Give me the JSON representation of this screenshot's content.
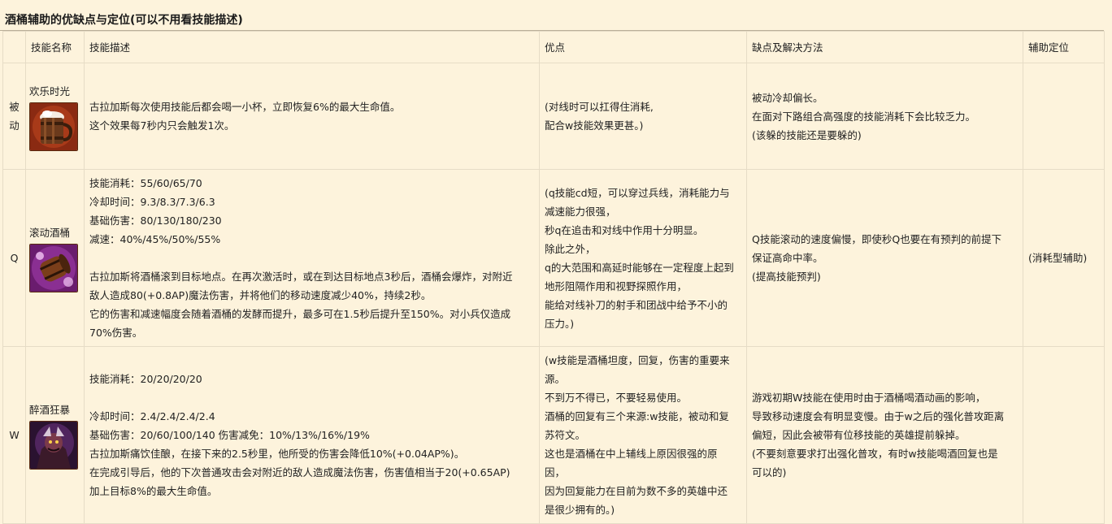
{
  "page": {
    "title": "酒桶辅助的优缺点与定位(可以不用看技能描述)"
  },
  "table": {
    "headers": [
      "",
      "技能名称",
      "技能描述",
      "优点",
      "缺点及解决方法",
      "辅助定位"
    ],
    "rows": [
      {
        "slot": "被\n动",
        "name": "欢乐时光",
        "icon": "beer-mug-icon",
        "desc": [
          "古拉加斯每次使用技能后都会喝一小杯，立即恢复6%的最大生命值。",
          "这个效果每7秒内只会触发1次。"
        ],
        "pros": [
          "(对线时可以扛得住消耗,",
          "配合w技能效果更甚。)"
        ],
        "cons": [
          "被动冷却偏长。",
          "在面对下路组合高强度的技能消耗下会比较乏力。",
          "(该躲的技能还是要躲的)"
        ],
        "role": ""
      },
      {
        "slot": "Q",
        "name": "滚动酒桶",
        "icon": "rolling-barrel-icon",
        "desc": [
          "技能消耗：55/60/65/70",
          "冷却时间：9.3/8.3/7.3/6.3",
          "基础伤害：80/130/180/230",
          "减速：40%/45%/50%/55%",
          "",
          "古拉加斯将酒桶滚到目标地点。在再次激活时，或在到达目标地点3秒后，酒桶会爆炸，对附近",
          "敌人造成80(+0.8AP)魔法伤害，并将他们的移动速度减少40%，持续2秒。",
          "它的伤害和减速幅度会随着酒桶的发酵而提升，最多可在1.5秒后提升至150%。对小兵仅造成",
          "70%伤害。"
        ],
        "pros": [
          "(q技能cd短，可以穿过兵线，消耗能力与",
          "减速能力很强，",
          "秒q在追击和对线中作用十分明显。",
          "除此之外，",
          "q的大范围和高延时能够在一定程度上起到",
          "地形阻隔作用和视野探照作用，",
          "能给对线补刀的射手和团战中给予不小的",
          "压力。)"
        ],
        "cons": [
          "Q技能滚动的速度偏慢，即使秒Q也要在有预判的前提下",
          "保证高命中率。",
          "(提高技能预判)"
        ],
        "role": "(消耗型辅助)"
      },
      {
        "slot": "W",
        "name": "醉酒狂暴",
        "icon": "drunken-rage-icon",
        "desc": [
          "技能消耗：20/20/20/20",
          "",
          "冷却时间：2.4/2.4/2.4/2.4",
          "基础伤害：20/60/100/140 伤害减免：10%/13%/16%/19%",
          "古拉加斯痛饮佳酿，在接下来的2.5秒里，他所受的伤害会降低10%(+0.04AP%)。",
          "在完成引导后，他的下次普通攻击会对附近的敌人造成魔法伤害，伤害值相当于20(+0.65AP)",
          "加上目标8%的最大生命值。"
        ],
        "pros": [
          "(w技能是酒桶坦度，回复，伤害的重要来",
          "源。",
          "不到万不得已，不要轻易使用。",
          "酒桶的回复有三个来源:w技能，被动和复",
          "苏符文。",
          "这也是酒桶在中上辅线上原因很强的原",
          "因，",
          "因为回复能力在目前为数不多的英雄中还",
          "是很少拥有的。)"
        ],
        "cons": [
          "游戏初期W技能在使用时由于酒桶喝酒动画的影响，",
          "导致移动速度会有明显变慢。由于w之后的强化普攻距离",
          "偏短，因此会被带有位移技能的英雄提前躲掉。",
          "(不要刻意要求打出强化普攻，有时w技能喝酒回复也是",
          "可以的)"
        ],
        "role": ""
      }
    ]
  }
}
